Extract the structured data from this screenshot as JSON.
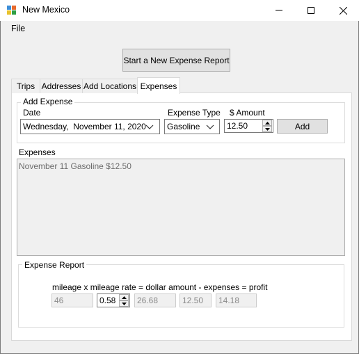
{
  "window": {
    "title": "New Mexico"
  },
  "menu": {
    "file": "File"
  },
  "toolbar": {
    "start_report": "Start a New Expense Report"
  },
  "tabs": [
    {
      "label": "Trips",
      "active": false
    },
    {
      "label": "Addresses",
      "active": false
    },
    {
      "label": "Add Locations",
      "active": false
    },
    {
      "label": "Expenses",
      "active": true
    }
  ],
  "add_expense": {
    "legend": "Add Expense",
    "date_label": "Date",
    "date_value": "Wednesday,  November 11, 2020",
    "type_label": "Expense Type",
    "type_value": "Gasoline",
    "amount_label": "$ Amount",
    "amount_value": "12.50",
    "add_button": "Add"
  },
  "expenses": {
    "label": "Expenses",
    "items": [
      "November 11 Gasoline $12.50"
    ]
  },
  "report": {
    "legend": "Expense Report",
    "formula": "mileage x mileage rate = dollar amount - expenses = profit",
    "mileage": "46",
    "rate": "0.58",
    "dollar_amount": "26.68",
    "expenses": "12.50",
    "profit": "14.18"
  },
  "colors": {
    "background": "#f0f0f0",
    "panel": "#ffffff",
    "button": "#e1e1e1"
  },
  "icons": {
    "app": "app-icon",
    "minimize": "minimize-icon",
    "maximize": "maximize-icon",
    "close": "close-icon",
    "dropdown": "chevron-down-icon",
    "spin_up": "spin-up-icon",
    "spin_down": "spin-down-icon"
  }
}
